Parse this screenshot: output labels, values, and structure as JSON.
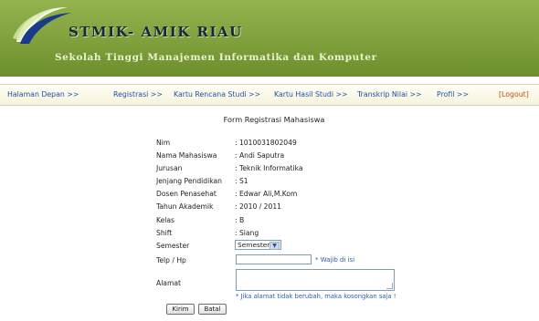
{
  "header": {
    "brand": "STMIK- AMIK RIAU",
    "tagline": "Sekolah Tinggi Manajemen Informatika dan Komputer"
  },
  "nav": {
    "items": [
      "Halaman Depan >>",
      "Registrasi >>",
      "Kartu Rencana Studi >>",
      "Kartu Hasil Studi >>",
      "Transkrip Nilai >>",
      "Profil >>"
    ],
    "logout": "[Logout]"
  },
  "form": {
    "title": "Form Registrasi Mahasiswa",
    "fields": [
      {
        "label": "Nim",
        "value": ": 1010031802049"
      },
      {
        "label": "Nama Mahasiswa",
        "value": ": Andi Saputra"
      },
      {
        "label": "Jurusan",
        "value": ": Teknik Informatika"
      },
      {
        "label": "Jenjang Pendidikan",
        "value": ": S1"
      },
      {
        "label": "Dosen Penasehat",
        "value": ": Edwar Ali,M.Kom"
      },
      {
        "label": "Tahun Akademik",
        "value": ": 2010 / 2011"
      },
      {
        "label": "Kelas",
        "value": ": B"
      },
      {
        "label": "Shift",
        "value": ": Siang"
      }
    ],
    "semester": {
      "label": "Semester",
      "selected": "Semester"
    },
    "telp": {
      "label": "Telp / Hp",
      "value": "",
      "hint": "* Wajib di isi"
    },
    "alamat": {
      "label": "Alamat",
      "value": "",
      "hint": "* Jika alamat tidak berubah, maka kosongkan saja !"
    },
    "buttons": {
      "submit": "Kirim",
      "cancel": "Batal"
    }
  },
  "colors": {
    "banner": "#7fa03c",
    "brand_text": "#14283f",
    "link": "#1f4fa8",
    "logout": "#c24b10",
    "hint": "#2f5bb7"
  }
}
